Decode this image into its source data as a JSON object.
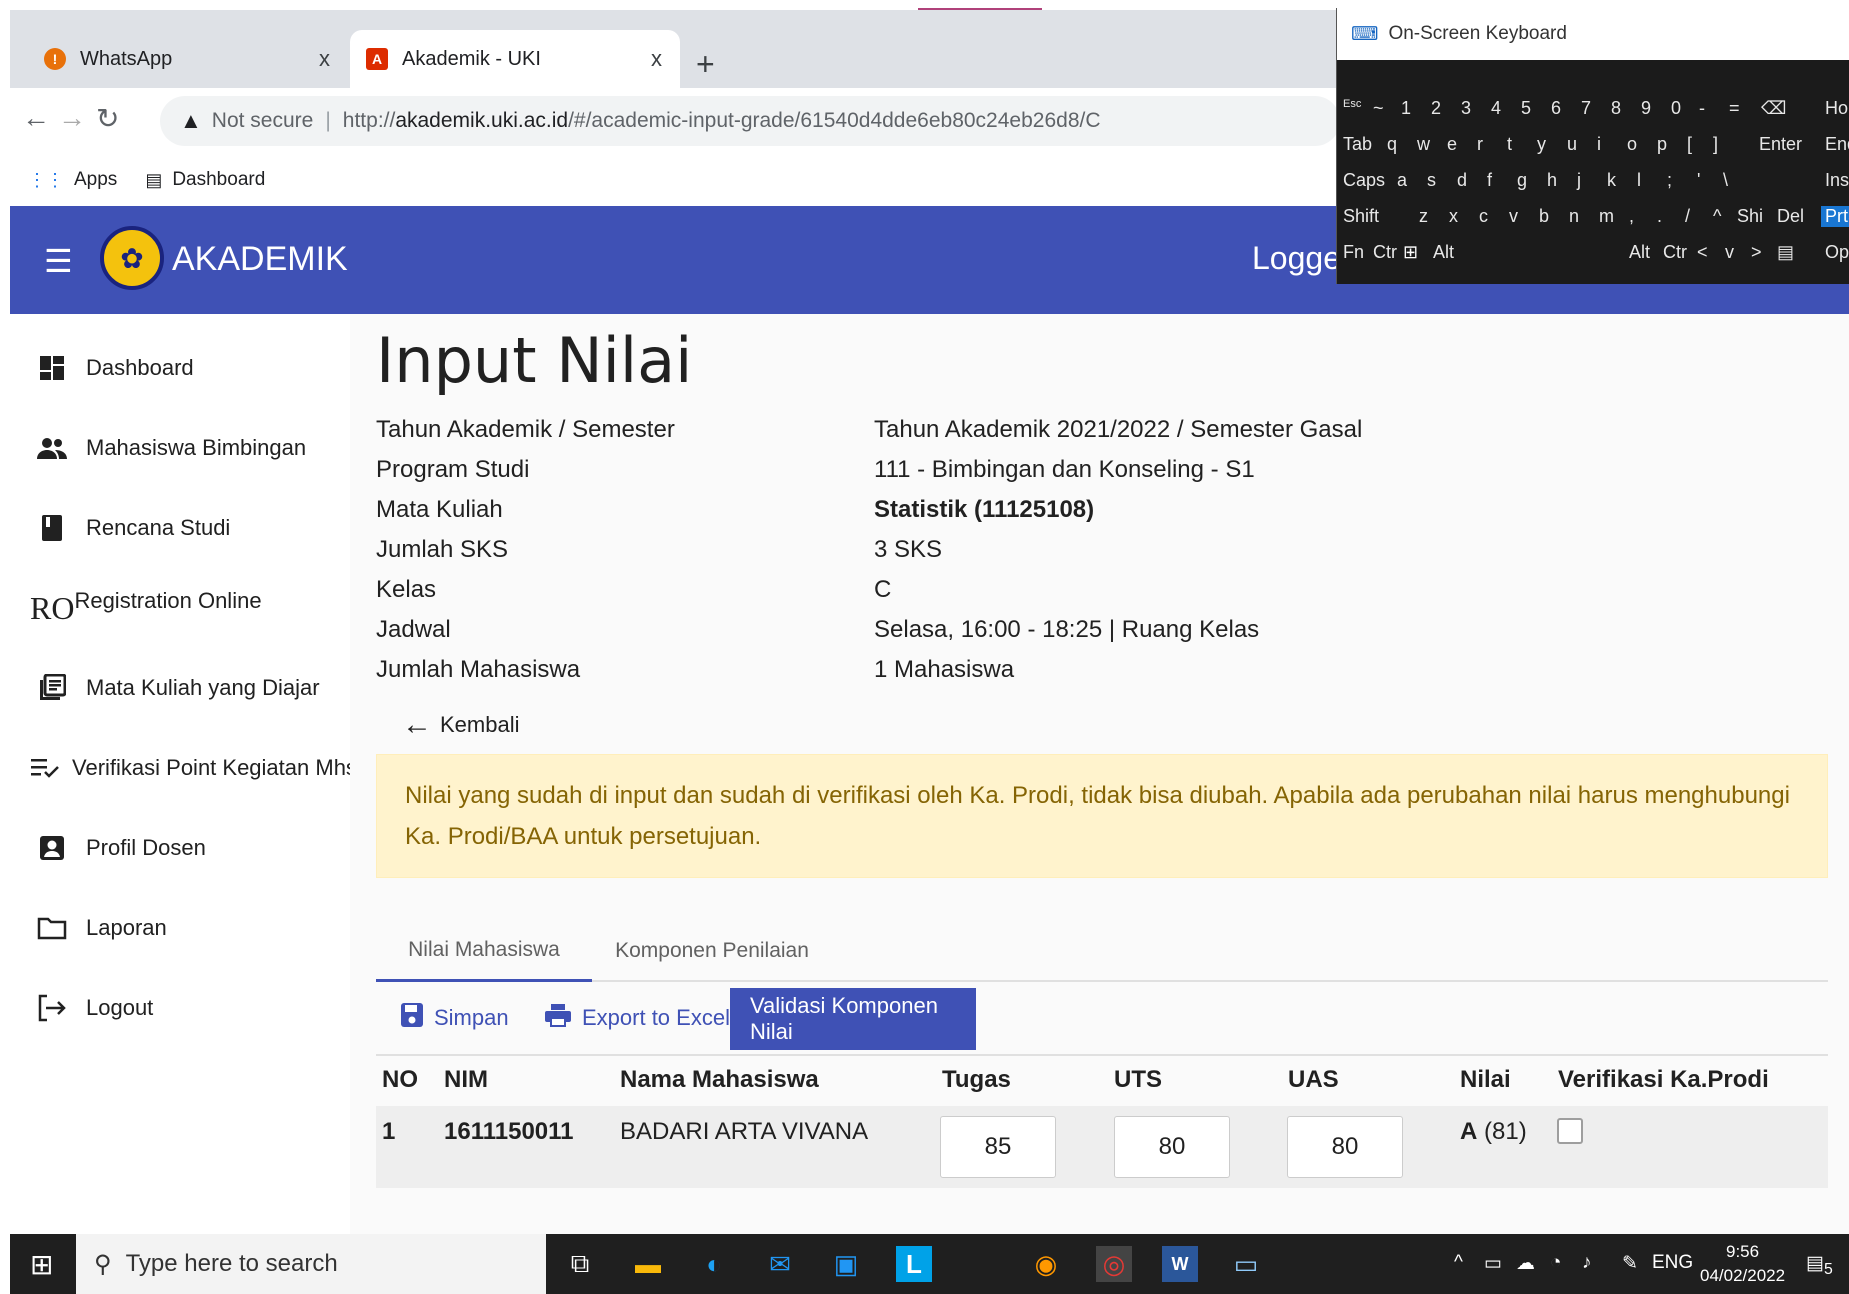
{
  "browser": {
    "tabs": [
      {
        "label": "WhatsApp",
        "close": "x"
      },
      {
        "label": "Akademik - UKI",
        "close": "x"
      }
    ],
    "new_tab": "+",
    "not_secure": "Not secure",
    "url_prefix": "http://",
    "url_host": "akademik.uki.ac.id",
    "url_path": "/#/academic-input-grade/61540d4dde6eb80c24eb26d8/C",
    "bookmarks": [
      "Apps",
      "Dashboard"
    ]
  },
  "header": {
    "brand": "AKADEMIK",
    "logged": "Logged"
  },
  "sidebar": {
    "items": [
      {
        "label": "Dashboard"
      },
      {
        "label": "Mahasiswa Bimbingan"
      },
      {
        "label": "Rencana Studi"
      },
      {
        "label": "Registration Online",
        "prefix": "RO"
      },
      {
        "label": "Mata Kuliah yang Diajar"
      },
      {
        "label": "Verifikasi Point Kegiatan Mhs."
      },
      {
        "label": "Profil Dosen"
      },
      {
        "label": "Laporan"
      },
      {
        "label": "Logout"
      }
    ]
  },
  "page": {
    "title": "Input Nilai",
    "info": [
      {
        "label": "Tahun Akademik / Semester",
        "value": "Tahun Akademik 2021/2022 / Semester Gasal"
      },
      {
        "label": "Program Studi",
        "value": "111 - Bimbingan dan Konseling - S1"
      },
      {
        "label": "Mata Kuliah",
        "value": "Statistik (11125108)"
      },
      {
        "label": "Jumlah SKS",
        "value": "3 SKS"
      },
      {
        "label": "Kelas",
        "value": "C"
      },
      {
        "label": "Jadwal",
        "value": "Selasa, 16:00 - 18:25 | Ruang Kelas"
      },
      {
        "label": "Jumlah Mahasiswa",
        "value": "1 Mahasiswa"
      }
    ],
    "back": "Kembali",
    "alert": "Nilai yang sudah di input dan sudah di verifikasi oleh Ka. Prodi, tidak bisa diubah. Apabila ada perubahan nilai harus menghubungi Ka. Prodi/BAA untuk persetujuan.",
    "tabs": [
      "Nilai Mahasiswa",
      "Komponen Penilaian"
    ],
    "actions": {
      "save": "Simpan",
      "export": "Export to Excel",
      "validate": "Validasi Komponen Nilai"
    },
    "table": {
      "headers": [
        "NO",
        "NIM",
        "Nama Mahasiswa",
        "Tugas",
        "UTS",
        "UAS",
        "Nilai",
        "Verifikasi Ka.Prodi"
      ],
      "rows": [
        {
          "no": "1",
          "nim": "1611150011",
          "name": "BADARI ARTA VIVANA",
          "tugas": "85",
          "uts": "80",
          "uas": "80",
          "grade_letter": "A",
          "grade_score": "(81)",
          "verified": false
        }
      ]
    }
  },
  "osk": {
    "title": "On-Screen Keyboard",
    "rows": [
      [
        "Esc",
        "~",
        "1",
        "2",
        "3",
        "4",
        "5",
        "6",
        "7",
        "8",
        "9",
        "0",
        "-",
        "=",
        "⌫",
        "Ho"
      ],
      [
        "Tab",
        "q",
        "w",
        "e",
        "r",
        "t",
        "y",
        "u",
        "i",
        "o",
        "p",
        "[",
        "]",
        "Enter",
        "End"
      ],
      [
        "Caps",
        "a",
        "s",
        "d",
        "f",
        "g",
        "h",
        "j",
        "k",
        "l",
        ";",
        "'",
        "\\",
        "Inse"
      ],
      [
        "Shift",
        "z",
        "x",
        "c",
        "v",
        "b",
        "n",
        "m",
        ",",
        ".",
        "/",
        "^",
        "Shi",
        "Del",
        "PrtS"
      ],
      [
        "Fn",
        "Ctr",
        "Alt",
        "Alt",
        "Ctr",
        "<",
        "v",
        ">",
        "Opt"
      ]
    ]
  },
  "taskbar": {
    "search_placeholder": "Type here to search",
    "lang": "ENG",
    "time": "9:56",
    "date": "04/02/2022",
    "notif_count": "5"
  },
  "colors": {
    "primary": "#3f51b5",
    "alert_bg": "#fff3cd",
    "alert_text": "#856404"
  }
}
